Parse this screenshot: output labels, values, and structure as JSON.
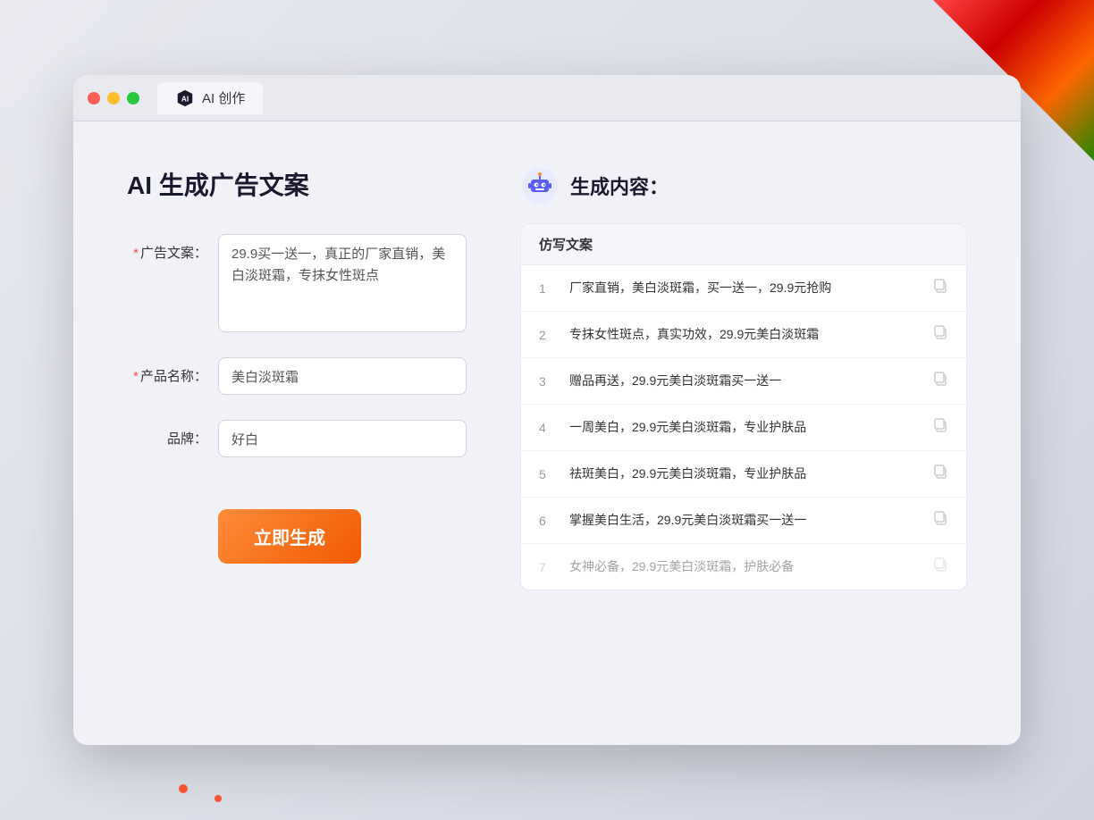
{
  "browser": {
    "tab_title": "AI 创作",
    "traffic_lights": [
      "red",
      "yellow",
      "green"
    ]
  },
  "left_panel": {
    "page_title": "AI 生成广告文案",
    "form": {
      "ad_copy_label": "广告文案：",
      "ad_copy_required": "*",
      "ad_copy_value": "29.9买一送一，真正的厂家直销，美白淡斑霜，专抹女性斑点",
      "product_name_label": "产品名称：",
      "product_name_required": "*",
      "product_name_value": "美白淡斑霜",
      "brand_label": "品牌：",
      "brand_value": "好白"
    },
    "generate_button": "立即生成"
  },
  "right_panel": {
    "title": "生成内容：",
    "table_header": "仿写文案",
    "results": [
      {
        "num": "1",
        "text": "厂家直销，美白淡斑霜，买一送一，29.9元抢购",
        "dimmed": false
      },
      {
        "num": "2",
        "text": "专抹女性斑点，真实功效，29.9元美白淡斑霜",
        "dimmed": false
      },
      {
        "num": "3",
        "text": "赠品再送，29.9元美白淡斑霜买一送一",
        "dimmed": false
      },
      {
        "num": "4",
        "text": "一周美白，29.9元美白淡斑霜，专业护肤品",
        "dimmed": false
      },
      {
        "num": "5",
        "text": "祛斑美白，29.9元美白淡斑霜，专业护肤品",
        "dimmed": false
      },
      {
        "num": "6",
        "text": "掌握美白生活，29.9元美白淡斑霜买一送一",
        "dimmed": false
      },
      {
        "num": "7",
        "text": "女神必备，29.9元美白淡斑霜，护肤必备",
        "dimmed": true
      }
    ]
  }
}
